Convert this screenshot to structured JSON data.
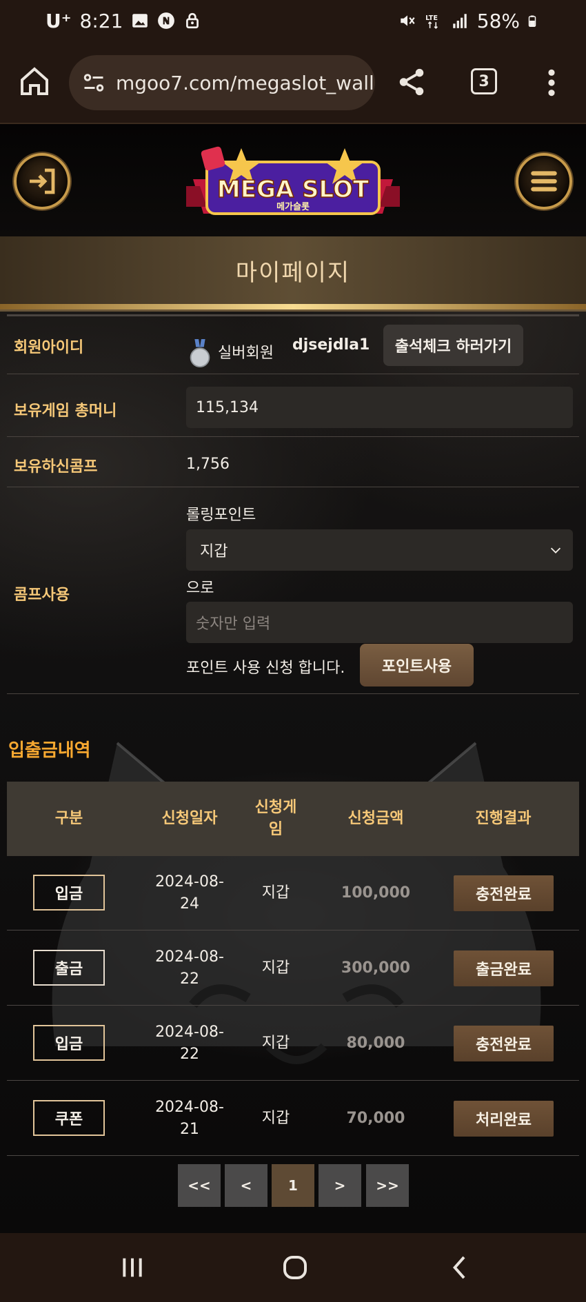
{
  "status_bar": {
    "carrier": "U⁺",
    "time": "8:21",
    "battery": "58%"
  },
  "browser": {
    "url": "mgoo7.com/megaslot_wall",
    "tab_count": "3"
  },
  "header": {
    "logo_text": "MEGA SLOT",
    "logo_sub": "메가슬롯"
  },
  "page_title": "마이페이지",
  "profile": {
    "member_id_label": "회원아이디",
    "level_name": "실버회원",
    "user_id": "djsejdla1",
    "attendance_button": "출석체크 하러가기",
    "game_money_label": "보유게임 총머니",
    "game_money_value": "115,134",
    "comp_label": "보유하신콤프",
    "comp_value": "1,756",
    "comp_use_label": "콤프사용",
    "rolling_point_label": "롤링포인트",
    "wallet_select_value": "지갑",
    "to_label": "으로",
    "amount_placeholder": "숫자만 입력",
    "apply_text": "포인트 사용 신청 합니다.",
    "use_points_button": "포인트사용"
  },
  "history": {
    "title": "입출금내역",
    "columns": [
      "구분",
      "신청일자",
      "신청게\n임",
      "신청금액",
      "진행결과"
    ],
    "rows": [
      {
        "type": "입금",
        "date": "2024-08-\n24",
        "game": "지갑",
        "amount": "100,000",
        "result": "충전완료"
      },
      {
        "type": "출금",
        "date": "2024-08-\n22",
        "game": "지갑",
        "amount": "300,000",
        "result": "출금완료"
      },
      {
        "type": "입금",
        "date": "2024-08-\n22",
        "game": "지갑",
        "amount": "80,000",
        "result": "충전완료"
      },
      {
        "type": "쿠폰",
        "date": "2024-08-\n21",
        "game": "지갑",
        "amount": "70,000",
        "result": "처리완료"
      }
    ]
  },
  "pagination": {
    "first": "<<",
    "prev": "<",
    "current": "1",
    "next": ">",
    "last": ">>"
  },
  "colors": {
    "gold": "#f6c878",
    "orange_title": "#f7a830",
    "brown_button": "#6f5237"
  }
}
